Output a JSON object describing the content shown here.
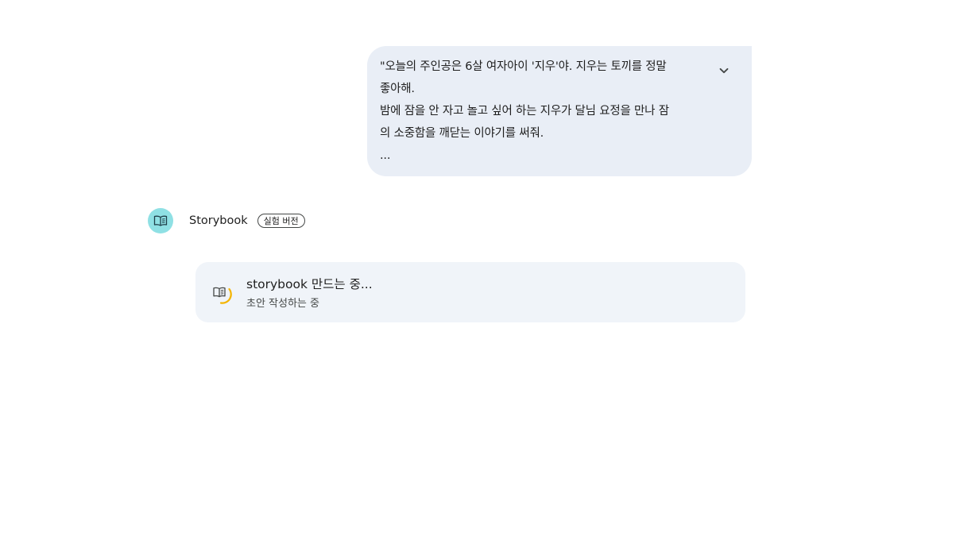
{
  "user_message": {
    "lines": [
      "\"오늘의 주인공은 6살 여자아이 '지우'야. 지우는 토끼를 정말",
      "좋아해.",
      "밤에 잠을 안 자고 놀고 싶어 하는 지우가 달님 요정을 만나 잠",
      "의 소중함을 깨닫는 이야기를 써줘.",
      "..."
    ],
    "expand_icon": "chevron-down-icon"
  },
  "bot": {
    "name": "Storybook",
    "badge": "실험 버전",
    "avatar_icon": "book-icon",
    "avatar_color": "#8fe0e4"
  },
  "progress": {
    "title": "storybook 만드는 중...",
    "subtitle": "초안 작성하는 중",
    "icon": "book-loading-icon",
    "spinner_color": "#f4b400"
  }
}
